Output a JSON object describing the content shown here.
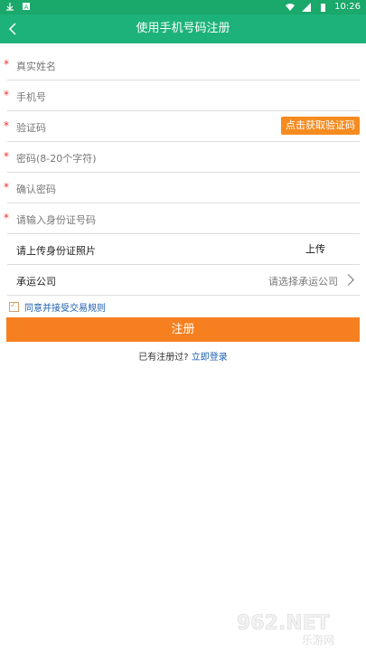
{
  "status": {
    "time": "10:26"
  },
  "header": {
    "title": "使用手机号码注册",
    "back_icon": "chevron-left-icon"
  },
  "form": {
    "real_name_placeholder": "真实姓名",
    "phone_placeholder": "手机号",
    "code_placeholder": "验证码",
    "get_code_button": "点击获取验证码",
    "password_placeholder": "密码(8-20个字符)",
    "confirm_password_placeholder": "确认密码",
    "id_number_placeholder": "请输入身份证号码",
    "id_photo_label": "请上传身份证照片",
    "upload_button": "上传",
    "carrier_label": "承运公司",
    "carrier_value": "请选择承运公司",
    "required_mark": "*"
  },
  "agree": {
    "label": "同意并接受交易规则",
    "checked": true
  },
  "actions": {
    "register": "注册",
    "login_prompt": "已有注册过?",
    "login_link": "立即登录"
  },
  "watermark": {
    "text": "962.NET",
    "subtext": "乐游网"
  },
  "colors": {
    "status_bar": "#1aa86b",
    "title_bar": "#1db27a",
    "accent": "#f6801f"
  }
}
